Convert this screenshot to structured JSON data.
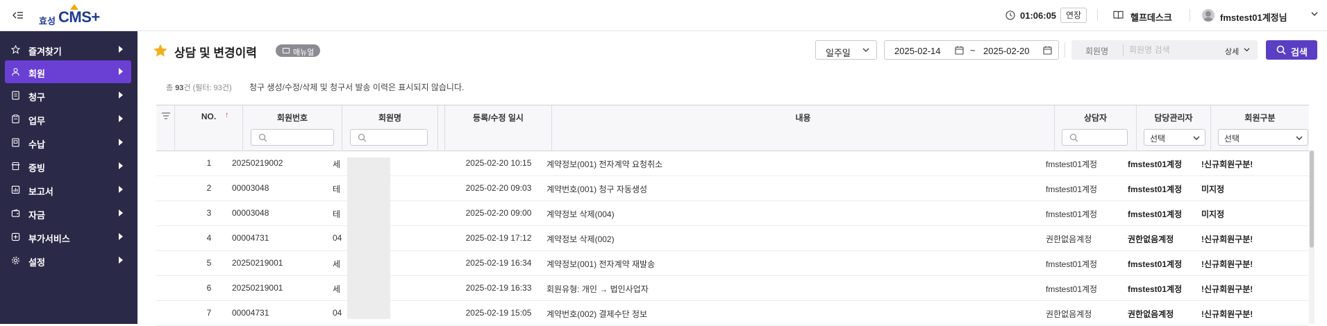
{
  "topbar": {
    "logo_prefix": "효성",
    "logo_main": "CMS+",
    "timer": "01:06:05",
    "extend_label": "연장",
    "help_label": "헬프데스크",
    "user_label": "fmstest01계정님"
  },
  "sidebar": {
    "items": [
      {
        "label": "즐겨찾기",
        "icon": "star-outline-icon"
      },
      {
        "label": "회원",
        "icon": "person-icon",
        "active": true
      },
      {
        "label": "청구",
        "icon": "invoice-icon"
      },
      {
        "label": "업무",
        "icon": "clipboard-icon"
      },
      {
        "label": "수납",
        "icon": "receipt-icon"
      },
      {
        "label": "증빙",
        "icon": "store-icon"
      },
      {
        "label": "보고서",
        "icon": "report-icon"
      },
      {
        "label": "자금",
        "icon": "wallet-icon"
      },
      {
        "label": "부가서비스",
        "icon": "plus-square-icon"
      },
      {
        "label": "설정",
        "icon": "gear-icon"
      }
    ]
  },
  "header": {
    "title": "상담 및 변경이력",
    "manual_label": "매뉴얼",
    "period_value": "일주일",
    "date_from": "2025-02-14",
    "date_sep": "~",
    "date_to": "2025-02-20",
    "search_field": "회원명",
    "search_placeholder": "회원명 검색",
    "detail_label": "상세",
    "search_button": "검색"
  },
  "summary": {
    "prefix": "총 ",
    "count": "93",
    "suffix": "건 (필터: 93건)",
    "notice": "청구 생성/수정/삭제 및 청구서 발송 이력은 표시되지 않습니다."
  },
  "table": {
    "columns": {
      "no": "NO.",
      "sort_arrow": "↑",
      "member_no": "회원번호",
      "member_name": "회원명",
      "datetime": "등록/수정 일시",
      "content": "내용",
      "counselor": "상담자",
      "manager": "담당관리자",
      "member_type": "회원구분"
    },
    "manager_filter": "선택",
    "type_filter": "선택",
    "rows": [
      {
        "no": "1",
        "member_no": "20250219002",
        "name": "세",
        "datetime": "2025-02-20 10:15",
        "content": "계약정보(001) 전자계약 요청취소",
        "counselor": "fmstest01계정",
        "manager": "fmstest01계정",
        "type": "!신규회원구분!"
      },
      {
        "no": "2",
        "member_no": "00003048",
        "name": "테",
        "datetime": "2025-02-20 09:03",
        "content": "계약번호(001) 청구 자동생성",
        "counselor": "fmstest01계정",
        "manager": "fmstest01계정",
        "type": "미지정"
      },
      {
        "no": "3",
        "member_no": "00003048",
        "name": "테",
        "datetime": "2025-02-20 09:00",
        "content": "계약정보 삭제(004)",
        "counselor": "fmstest01계정",
        "manager": "fmstest01계정",
        "type": "미지정"
      },
      {
        "no": "4",
        "member_no": "00004731",
        "name": "04",
        "datetime": "2025-02-19 17:12",
        "content": "계약정보 삭제(002)",
        "counselor": "권한없음계정",
        "manager": "권한없음계정",
        "type": "!신규회원구분!"
      },
      {
        "no": "5",
        "member_no": "20250219001",
        "name": "세",
        "datetime": "2025-02-19 16:34",
        "content": "계약정보(001) 전자계약 재발송",
        "counselor": "fmstest01계정",
        "manager": "fmstest01계정",
        "type": "!신규회원구분!"
      },
      {
        "no": "6",
        "member_no": "20250219001",
        "name": "세",
        "datetime": "2025-02-19 16:33",
        "content": "회원유형: 개인 → 법인사업자",
        "counselor": "fmstest01계정",
        "manager": "fmstest01계정",
        "type": "!신규회원구분!"
      },
      {
        "no": "7",
        "member_no": "00004731",
        "name": "04",
        "datetime": "2025-02-19 15:05",
        "content": "계약번호(002) 결제수단 정보",
        "counselor": "권한없음계정",
        "manager": "권한없음계정",
        "type": "!신규회원구분!"
      }
    ]
  },
  "colors": {
    "sidebar_bg": "#2b2948",
    "accent": "#6a3fd4",
    "search_button": "#5a3fc4",
    "star": "#f2b01e"
  }
}
